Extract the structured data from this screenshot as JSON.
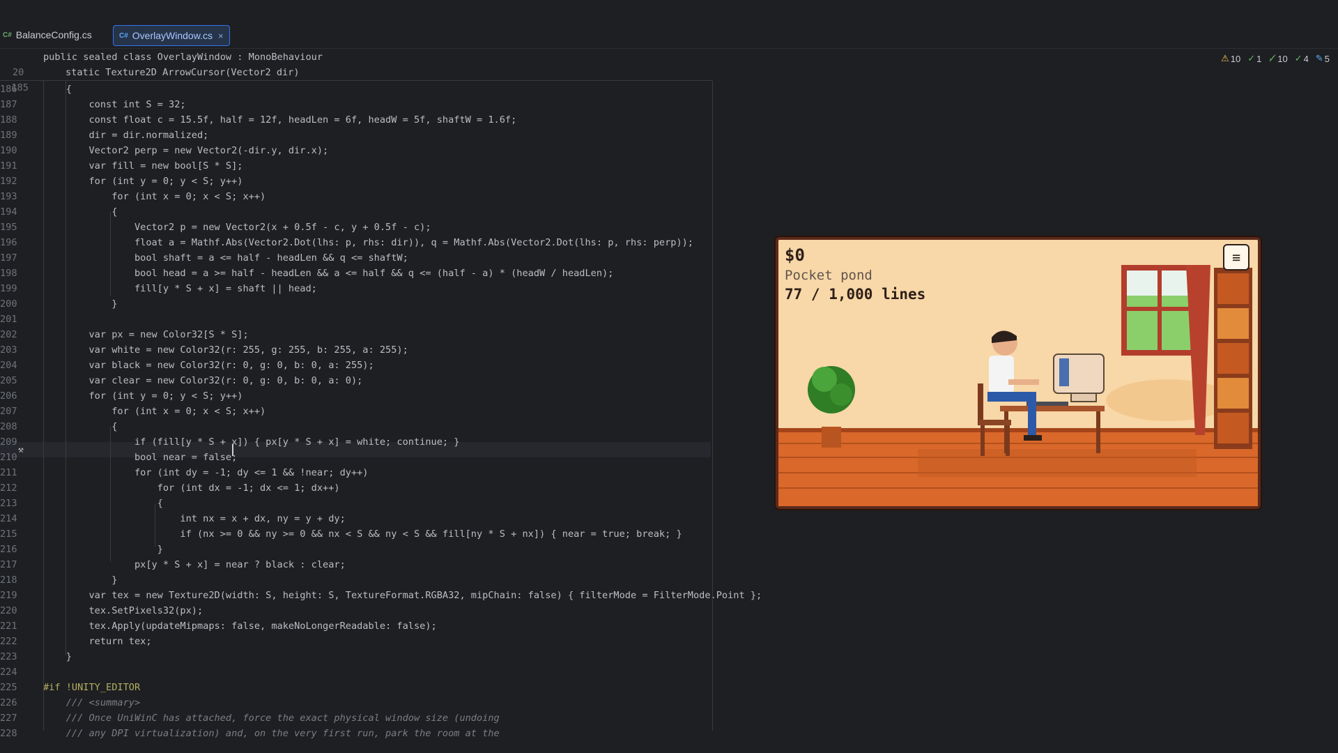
{
  "tabs": [
    {
      "lang": "C#",
      "label": "BalanceConfig.cs"
    },
    {
      "lang": "C#",
      "label": "OverlayWindow.cs",
      "close": "×"
    }
  ],
  "inspections": {
    "warnings": "10",
    "weak_warnings": "1",
    "typos": "10",
    "ok": "4",
    "info": "5"
  },
  "sticky": [
    {
      "ln": "20",
      "code": "public sealed class OverlayWindow : MonoBehaviour"
    },
    {
      "ln": "185",
      "code": "static Texture2D ArrowCursor(Vector2 dir)"
    }
  ],
  "code_lines": [
    {
      "ln": "186",
      "text": "    {"
    },
    {
      "ln": "187",
      "text": "        const int S = 32;"
    },
    {
      "ln": "188",
      "text": "        const float c = 15.5f, half = 12f, headLen = 6f, headW = 5f, shaftW = 1.6f;"
    },
    {
      "ln": "189",
      "text": "        dir = dir.normalized;"
    },
    {
      "ln": "190",
      "text": "        Vector2 perp = new Vector2(-dir.y, dir.x);"
    },
    {
      "ln": "191",
      "text": "        var fill = new bool[S * S];"
    },
    {
      "ln": "192",
      "text": "        for (int y = 0; y < S; y++)"
    },
    {
      "ln": "193",
      "text": "            for (int x = 0; x < S; x++)"
    },
    {
      "ln": "194",
      "text": "            {"
    },
    {
      "ln": "195",
      "text": "                Vector2 p = new Vector2(x + 0.5f - c, y + 0.5f - c);"
    },
    {
      "ln": "196",
      "text": "                float a = Mathf.Abs(Vector2.Dot(lhs: p, rhs: dir)), q = Mathf.Abs(Vector2.Dot(lhs: p, rhs: perp));"
    },
    {
      "ln": "197",
      "text": "                bool shaft = a <= half - headLen && q <= shaftW;"
    },
    {
      "ln": "198",
      "text": "                bool head = a >= half - headLen && a <= half && q <= (half - a) * (headW / headLen);"
    },
    {
      "ln": "199",
      "text": "                fill[y * S + x] = shaft || head;"
    },
    {
      "ln": "200",
      "text": "            }"
    },
    {
      "ln": "201",
      "text": ""
    },
    {
      "ln": "202",
      "text": "        var px = new Color32[S * S];"
    },
    {
      "ln": "203",
      "text": "        var white = new Color32(r: 255, g: 255, b: 255, a: 255);"
    },
    {
      "ln": "204",
      "text": "        var black = new Color32(r: 0, g: 0, b: 0, a: 255);"
    },
    {
      "ln": "205",
      "text": "        var clear = new Color32(r: 0, g: 0, b: 0, a: 0);"
    },
    {
      "ln": "206",
      "text": "        for (int y = 0; y < S; y++)"
    },
    {
      "ln": "207",
      "text": "            for (int x = 0; x < S; x++)"
    },
    {
      "ln": "208",
      "text": "            {"
    },
    {
      "ln": "209",
      "text": "                if (fill[y * S + x]) { px[y * S + x] = white; continue; }"
    },
    {
      "ln": "210",
      "text": "                bool near = false;"
    },
    {
      "ln": "211",
      "text": "                for (int dy = -1; dy <= 1 && !near; dy++)"
    },
    {
      "ln": "212",
      "text": "                    for (int dx = -1; dx <= 1; dx++)"
    },
    {
      "ln": "213",
      "text": "                    {"
    },
    {
      "ln": "214",
      "text": "                        int nx = x + dx, ny = y + dy;"
    },
    {
      "ln": "215",
      "text": "                        if (nx >= 0 && ny >= 0 && nx < S && ny < S && fill[ny * S + nx]) { near = true; break; }"
    },
    {
      "ln": "216",
      "text": "                    }"
    },
    {
      "ln": "217",
      "text": "                px[y * S + x] = near ? black : clear;"
    },
    {
      "ln": "218",
      "text": "            }"
    },
    {
      "ln": "219",
      "text": "        var tex = new Texture2D(width: S, height: S, TextureFormat.RGBA32, mipChain: false) { filterMode = FilterMode.Point };"
    },
    {
      "ln": "220",
      "text": "        tex.SetPixels32(px);"
    },
    {
      "ln": "221",
      "text": "        tex.Apply(updateMipmaps: false, makeNoLongerReadable: false);"
    },
    {
      "ln": "222",
      "text": "        return tex;"
    },
    {
      "ln": "223",
      "text": "    }"
    },
    {
      "ln": "224",
      "text": ""
    },
    {
      "ln": "225",
      "text": "#if !UNITY_EDITOR"
    },
    {
      "ln": "226",
      "text": "    /// <summary>"
    },
    {
      "ln": "227",
      "text": "    /// Once UniWinC has attached, force the exact physical window size (undoing"
    },
    {
      "ln": "228",
      "text": "    /// any DPI virtualization) and, on the very first run, park the room at the"
    }
  ],
  "game": {
    "money": "$0",
    "room_name": "Pocket pond",
    "lines": "77 / 1,000 lines",
    "menu_icon": "≡",
    "colors": {
      "wall": "#f8d7a8",
      "floor": "#d9682a",
      "border": "#5b2a1b"
    }
  }
}
